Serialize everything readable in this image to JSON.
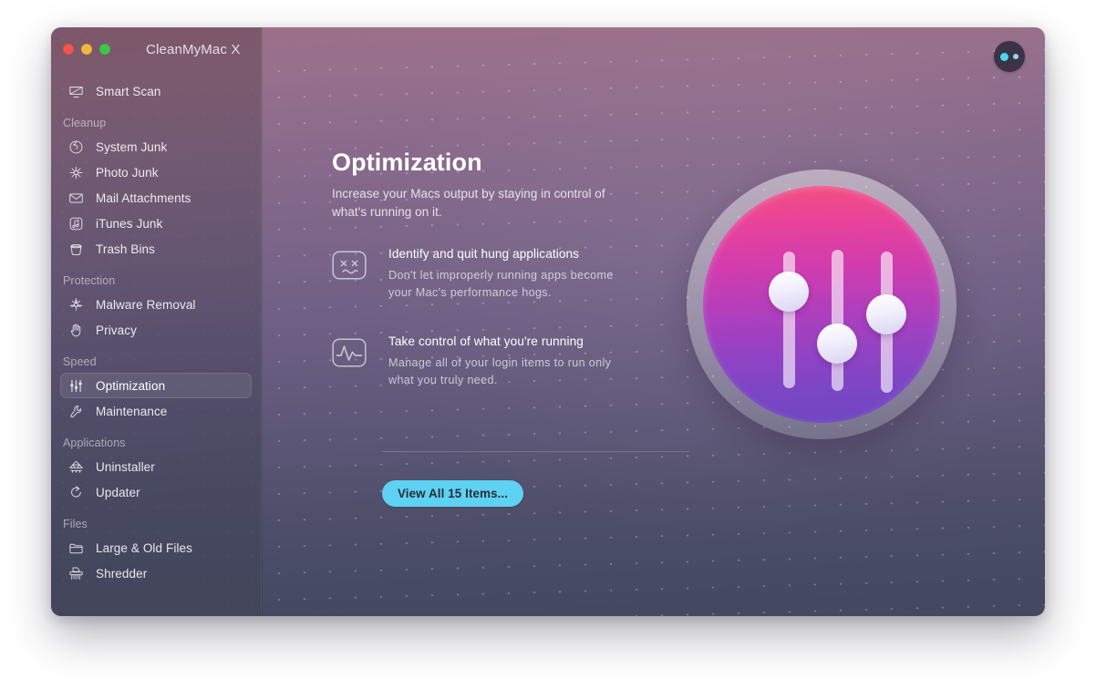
{
  "window": {
    "title": "CleanMyMac X",
    "traffic_lights": [
      "close",
      "minimize",
      "maximize"
    ]
  },
  "assistant": {
    "name": "assistant-button"
  },
  "sidebar": {
    "top_items": [
      {
        "label": "Smart Scan",
        "icon": "monitor-icon",
        "selected": false
      }
    ],
    "groups": [
      {
        "title": "Cleanup",
        "items": [
          {
            "label": "System Junk",
            "icon": "system-junk-icon",
            "selected": false
          },
          {
            "label": "Photo Junk",
            "icon": "photo-junk-icon",
            "selected": false
          },
          {
            "label": "Mail Attachments",
            "icon": "envelope-icon",
            "selected": false
          },
          {
            "label": "iTunes Junk",
            "icon": "music-note-icon",
            "selected": false
          },
          {
            "label": "Trash Bins",
            "icon": "trash-bin-icon",
            "selected": false
          }
        ]
      },
      {
        "title": "Protection",
        "items": [
          {
            "label": "Malware Removal",
            "icon": "biohazard-icon",
            "selected": false
          },
          {
            "label": "Privacy",
            "icon": "hand-icon",
            "selected": false
          }
        ]
      },
      {
        "title": "Speed",
        "items": [
          {
            "label": "Optimization",
            "icon": "sliders-icon",
            "selected": true
          },
          {
            "label": "Maintenance",
            "icon": "wrench-icon",
            "selected": false
          }
        ]
      },
      {
        "title": "Applications",
        "items": [
          {
            "label": "Uninstaller",
            "icon": "uninstaller-icon",
            "selected": false
          },
          {
            "label": "Updater",
            "icon": "refresh-arrow-icon",
            "selected": false
          }
        ]
      },
      {
        "title": "Files",
        "items": [
          {
            "label": "Large & Old Files",
            "icon": "folder-icon",
            "selected": false
          },
          {
            "label": "Shredder",
            "icon": "shredder-icon",
            "selected": false
          }
        ]
      }
    ]
  },
  "content": {
    "title": "Optimization",
    "subtitle": "Increase your Macs output by staying in control of what's running on it.",
    "features": [
      {
        "icon": "hung-app-face-icon",
        "title": "Identify and quit hung applications",
        "description": "Don't let improperly running apps become your Mac's performance hogs."
      },
      {
        "icon": "activity-monitor-icon",
        "title": "Take control of what you're running",
        "description": "Manage all of your login items to run only what you truly need."
      }
    ],
    "primary_button": "View All 15 Items...",
    "hero": {
      "icon": "sliders-hero-icon",
      "sliders": 3
    }
  },
  "colors": {
    "accent_button": "#5ed2f2",
    "assistant_dot": "#4cd6f0",
    "hero_gradient_start": "#f2507f",
    "hero_gradient_end": "#6f47c1",
    "sidebar_top": "#7e5769",
    "sidebar_bottom": "#43455b",
    "main_top": "#9c6f88",
    "main_bottom": "#43475f"
  }
}
